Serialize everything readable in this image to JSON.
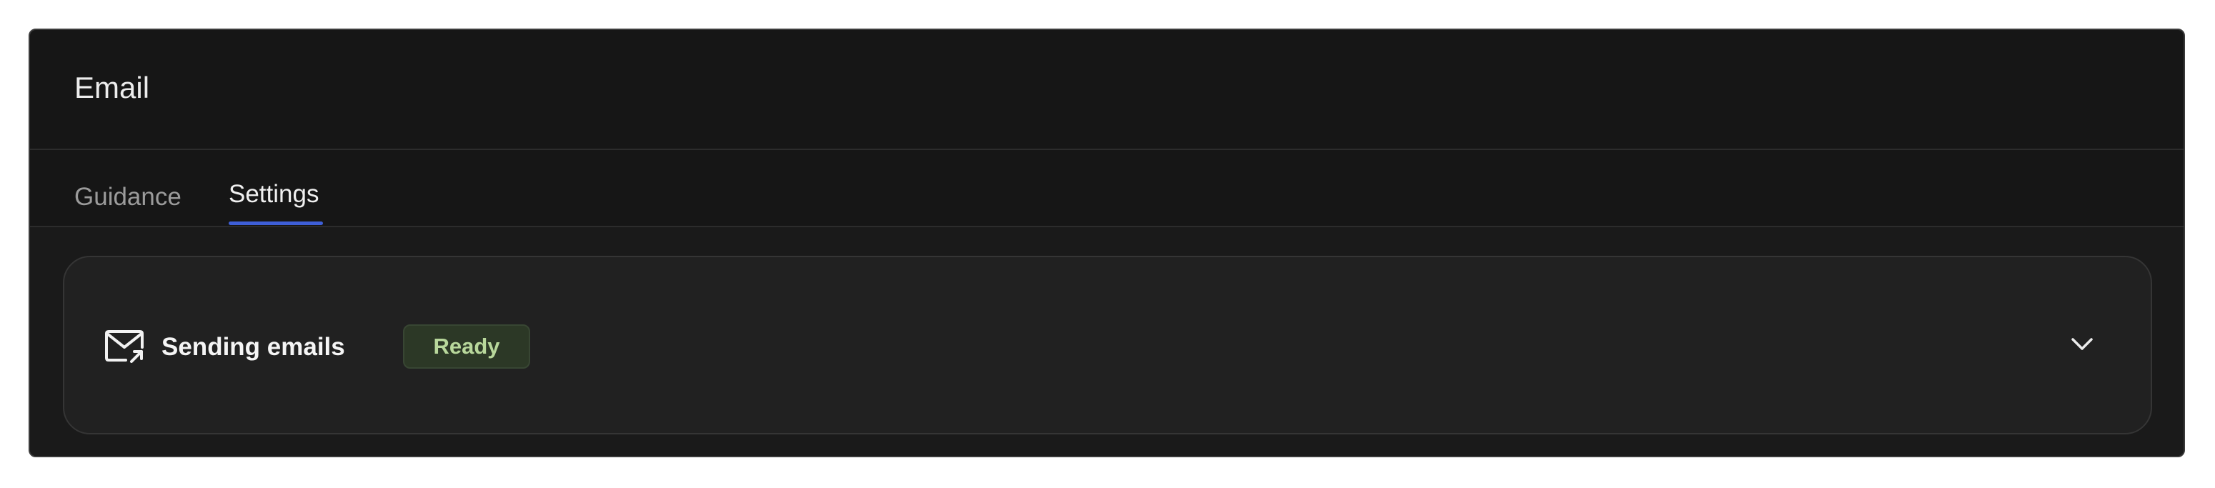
{
  "panel": {
    "title": "Email"
  },
  "tabs": [
    {
      "label": "Guidance",
      "active": false
    },
    {
      "label": "Settings",
      "active": true
    }
  ],
  "card": {
    "icon": "mail-send-icon",
    "title": "Sending emails",
    "status": "Ready",
    "expand_icon": "chevron-down-icon"
  },
  "colors": {
    "background": "#161616",
    "active_tab_underline": "#3e5fd8",
    "status_ready_bg": "#2c3826",
    "status_ready_text": "#b8d79b"
  }
}
